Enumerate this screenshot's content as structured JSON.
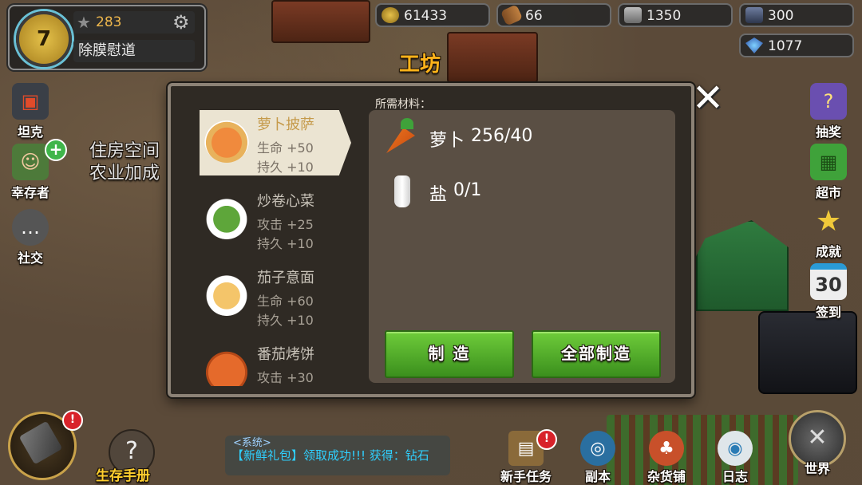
{
  "player": {
    "level": "7",
    "score": "283",
    "name": "除膜慰道"
  },
  "resources": {
    "coins": "61433",
    "wood": "66",
    "iron": "1350",
    "steel": "300",
    "gems": "1077"
  },
  "workshop": {
    "title": "工坊",
    "materials_label": "所需材料：",
    "recipes": [
      {
        "name": "萝卜披萨",
        "stat1": "生命 +50",
        "stat2": "持久 +10",
        "icon": "pizza"
      },
      {
        "name": "炒卷心菜",
        "stat1": "攻击 +25",
        "stat2": "持久 +10",
        "icon": "salad"
      },
      {
        "name": "茄子意面",
        "stat1": "生命 +60",
        "stat2": "持久 +10",
        "icon": "pasta"
      },
      {
        "name": "番茄烤饼",
        "stat1": "攻击 +30",
        "stat2": "",
        "icon": "pie"
      }
    ],
    "materials": [
      {
        "name": "萝卜",
        "quantity": "256/40",
        "icon": "carrot-icon"
      },
      {
        "name": "盐",
        "quantity": "0/1",
        "icon": "salt-bottle-icon"
      }
    ],
    "craft_label": "制 造",
    "craft_all_label": "全部制造",
    "close_symbol": "✕"
  },
  "left_menu": {
    "tank": "坦克",
    "survivors": "幸存者",
    "social": "社交"
  },
  "bonus_text": {
    "line1": "住房空间",
    "line2": "农业加成"
  },
  "right_menu": {
    "lottery": "抽奖",
    "supermarket": "超市",
    "achievements": "成就",
    "checkin": "签到",
    "checkin_day": "30"
  },
  "bottom": {
    "guide": "生存手册",
    "chat_channel": "<系统>",
    "chat_message": "【新鲜礼包】领取成功!!! 获得：钻石",
    "newbie_tasks": "新手任务",
    "dungeon": "副本",
    "grocery": "杂货铺",
    "log": "日志",
    "world": "世界",
    "alert": "!"
  },
  "colors": {
    "accent_gold": "#ffb31a",
    "button_green": "#4fa82a",
    "alert_red": "#d8222a",
    "chat_cyan": "#2fd0ff"
  }
}
